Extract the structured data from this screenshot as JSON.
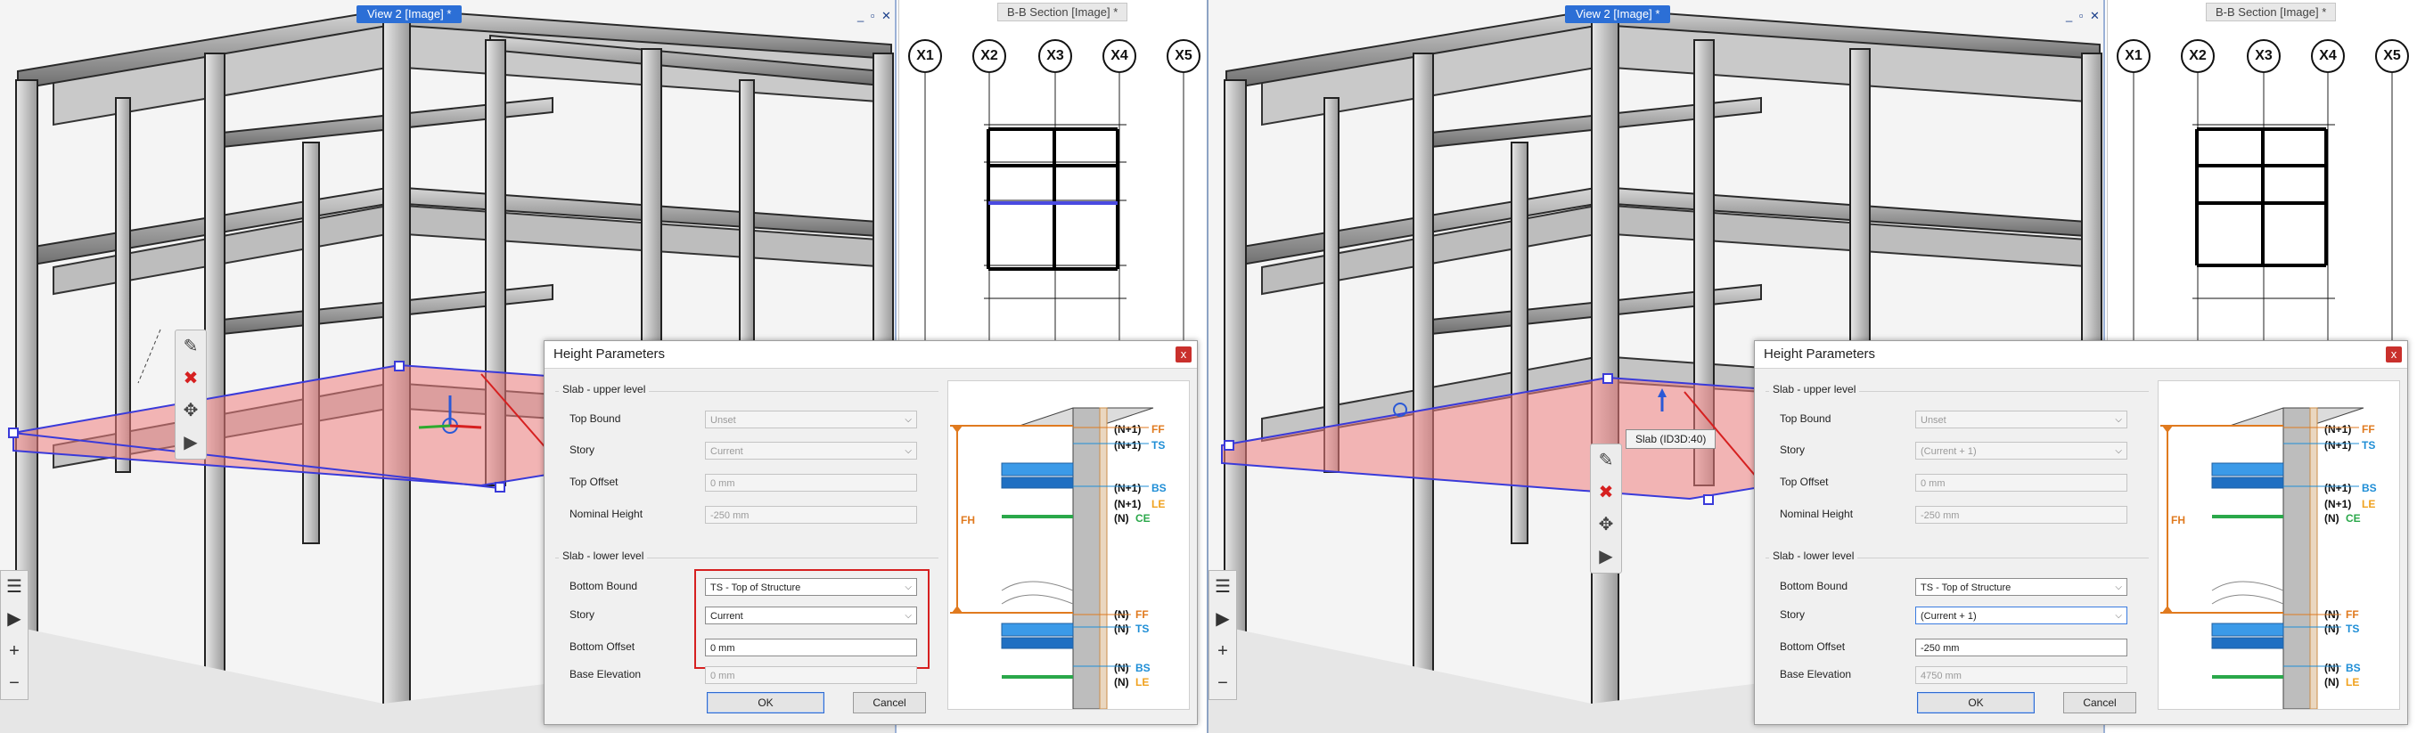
{
  "left": {
    "view_tab": "View 2 [Image] *",
    "win_ctrls": "_ ▫ ✕",
    "section_tab": "B-B Section [Image] *",
    "grids": [
      "X1",
      "X2",
      "X3",
      "X4",
      "X5"
    ],
    "dialog": {
      "title": "Height Parameters",
      "close": "x",
      "upper_group": "Slab - upper level",
      "lower_group": "Slab - lower level",
      "top_bound_label": "Top Bound",
      "top_bound_value": "Unset",
      "story_upper_label": "Story",
      "story_upper_value": "Current",
      "top_offset_label": "Top Offset",
      "top_offset_value": "0 mm",
      "nominal_label": "Nominal Height",
      "nominal_value": "-250 mm",
      "bottom_bound_label": "Bottom Bound",
      "bottom_bound_value": "TS - Top of Structure",
      "story_lower_label": "Story",
      "story_lower_value": "Current",
      "bottom_offset_label": "Bottom Offset",
      "bottom_offset_value": "0 mm",
      "base_elev_label": "Base Elevation",
      "base_elev_value": "0 mm",
      "ok": "OK",
      "cancel": "Cancel"
    }
  },
  "right": {
    "view_tab": "View 2 [Image] *",
    "win_ctrls": "_ ▫ ✕",
    "section_tab": "B-B Section [Image] *",
    "grids": [
      "X1",
      "X2",
      "X3",
      "X4",
      "X5"
    ],
    "tooltip": "Slab (ID3D:40)",
    "dialog": {
      "title": "Height Parameters",
      "close": "x",
      "upper_group": "Slab - upper level",
      "lower_group": "Slab - lower level",
      "top_bound_label": "Top Bound",
      "top_bound_value": "Unset",
      "story_upper_label": "Story",
      "story_upper_value": "(Current + 1)",
      "top_offset_label": "Top Offset",
      "top_offset_value": "0 mm",
      "nominal_label": "Nominal Height",
      "nominal_value": "-250 mm",
      "bottom_bound_label": "Bottom Bound",
      "bottom_bound_value": "TS - Top of Structure",
      "story_lower_label": "Story",
      "story_lower_value": "(Current + 1)",
      "bottom_offset_label": "Bottom Offset",
      "bottom_offset_value": "-250 mm",
      "base_elev_label": "Base Elevation",
      "base_elev_value": "4750 mm",
      "ok": "OK",
      "cancel": "Cancel"
    }
  },
  "diagram_labels": {
    "fh": "FH",
    "n1": "(N+1)",
    "n": "(N)",
    "ff": "FF",
    "ts": "TS",
    "bs": "BS",
    "le": "LE",
    "ce": "CE"
  },
  "colors": {
    "accent": "#2c6fd6",
    "slab_highlight": "#f08080",
    "ff": "#e07a1f",
    "ts": "#1f8ed6",
    "bs": "#1f8ed6",
    "le": "#f0a21f",
    "ce": "#2aa84a",
    "arrow": "#d62020"
  }
}
